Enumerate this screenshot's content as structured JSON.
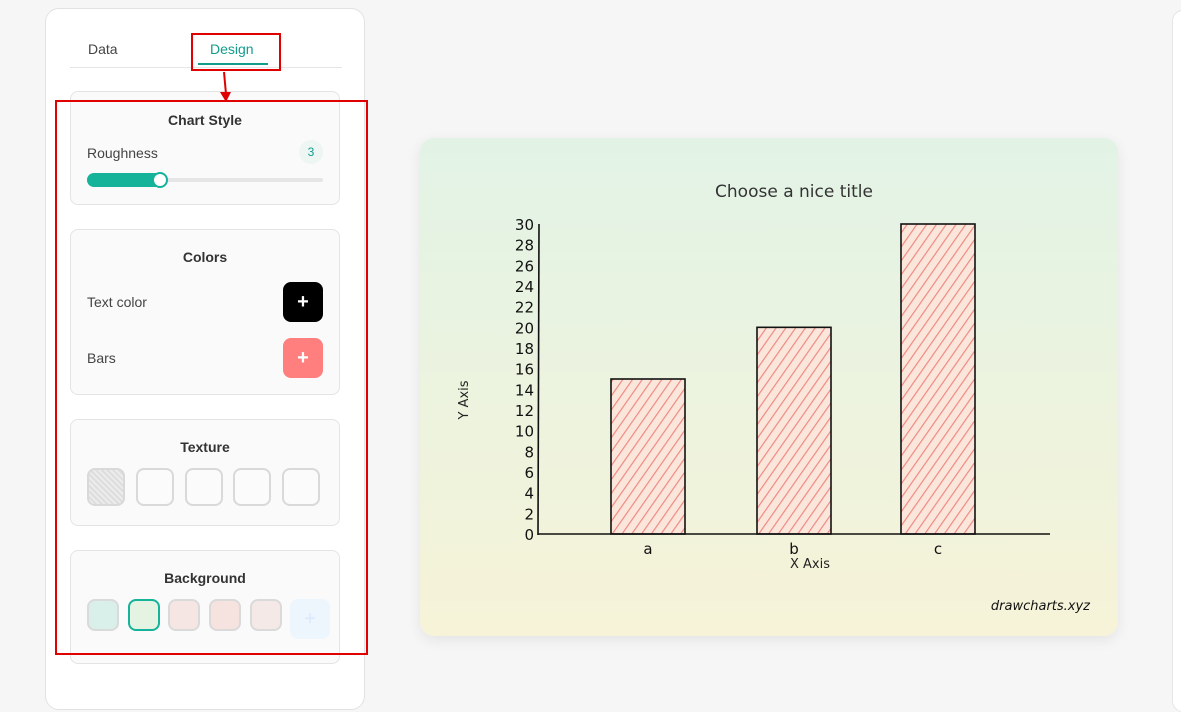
{
  "tabs": {
    "data": "Data",
    "design": "Design"
  },
  "chart_style": {
    "title": "Chart Style",
    "roughness_label": "Roughness",
    "roughness_value": "3",
    "roughness_fraction": 0.3
  },
  "colors": {
    "title": "Colors",
    "text_color_label": "Text color",
    "bars_label": "Bars",
    "text_color": "#000000",
    "bars_color": "#ff7e7e",
    "plus": "+"
  },
  "texture": {
    "title": "Texture"
  },
  "background": {
    "title": "Background",
    "swatches": [
      "#d9efea",
      "#e4f3e2",
      "#f5e6e4",
      "#f6e2df",
      "#f5e9e8"
    ],
    "selected": 1,
    "plus": "+"
  },
  "chart_data": {
    "type": "bar",
    "title": "Choose a nice title",
    "xlabel": "X Axis",
    "ylabel": "Y Axis",
    "categories": [
      "a",
      "b",
      "c"
    ],
    "values": [
      15,
      20,
      30
    ],
    "ylim": [
      0,
      30
    ],
    "yticks": [
      "0",
      "2",
      "4",
      "6",
      "8",
      "10",
      "12",
      "14",
      "16",
      "18",
      "20",
      "22",
      "24",
      "26",
      "28",
      "30"
    ],
    "bar_color": "#f28b82",
    "watermark": "drawcharts.xyz"
  }
}
